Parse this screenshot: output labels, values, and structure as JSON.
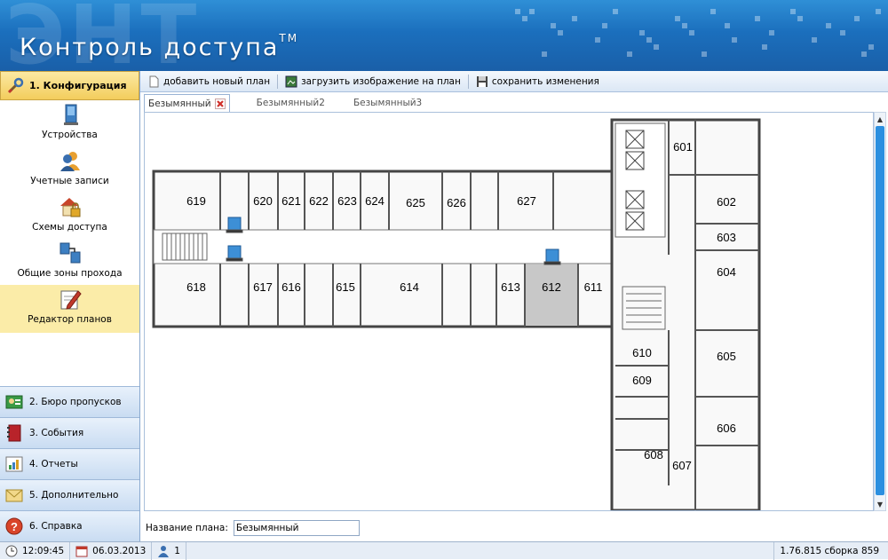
{
  "app": {
    "watermark": "ЭНТ",
    "title": "Контроль доступа",
    "trademark": "TM"
  },
  "sidebar": {
    "section": {
      "label": "1. Конфигурация",
      "icon": "wrench-icon"
    },
    "items": [
      {
        "label": "Устройства",
        "icon": "device-icon"
      },
      {
        "label": "Учетные записи",
        "icon": "users-icon"
      },
      {
        "label": "Схемы доступа",
        "icon": "house-lock-icon"
      },
      {
        "label": "Общие зоны прохода",
        "icon": "zones-icon"
      },
      {
        "label": "Редактор планов",
        "icon": "plan-editor-icon",
        "active": true
      }
    ],
    "groups": [
      {
        "label": "2. Бюро пропусков",
        "icon": "badge-icon"
      },
      {
        "label": "3. События",
        "icon": "book-icon"
      },
      {
        "label": "4. Отчеты",
        "icon": "report-icon"
      },
      {
        "label": "5. Дополнительно",
        "icon": "envelope-icon"
      },
      {
        "label": "6. Справка",
        "icon": "help-icon"
      }
    ]
  },
  "toolbar": {
    "add_plan": "добавить новый план",
    "load_image": "загрузить изображение на план",
    "save_changes": "сохранить изменения"
  },
  "tabs": [
    {
      "label": "Безымянный",
      "active": true
    },
    {
      "label": "Безымянный2"
    },
    {
      "label": "Безымянный3"
    }
  ],
  "plan": {
    "rooms_top": [
      "619",
      "620",
      "621",
      "622",
      "623",
      "624",
      "625",
      "626",
      "627"
    ],
    "rooms_bottom": [
      "618",
      "617",
      "616",
      "615",
      "614",
      "613",
      "612",
      "611"
    ],
    "rooms_right": [
      "601",
      "602",
      "603",
      "604",
      "605",
      "606",
      "607",
      "608",
      "609",
      "610"
    ],
    "highlighted_room": "612"
  },
  "plan_name": {
    "label": "Название плана:",
    "value": "Безымянный"
  },
  "status": {
    "time": "12:09:45",
    "date": "06.03.2013",
    "users": "1",
    "version": "1.76.815 сборка 859"
  },
  "colors": {
    "header": "#1b6fbd",
    "active_section": "#f3cd5c",
    "scroll_thumb": "#2b8fe0"
  }
}
